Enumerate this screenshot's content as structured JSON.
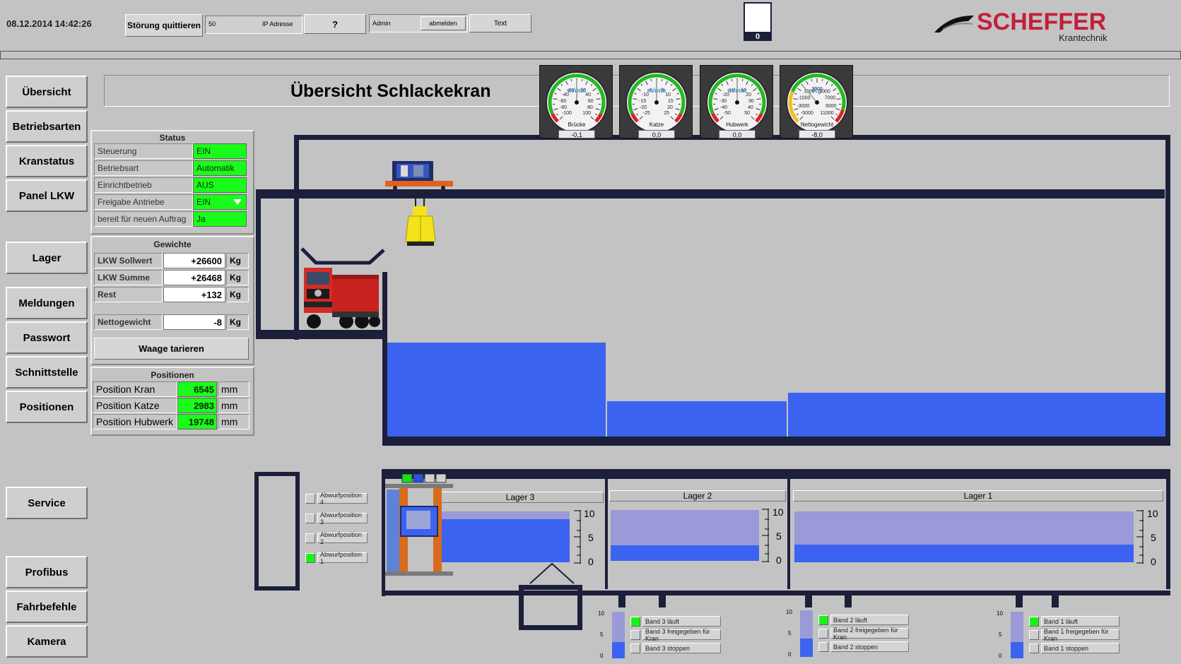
{
  "header": {
    "datetime": "08.12.2014 14:42:26",
    "ack_button": "Störung quittieren",
    "ip_value": "50",
    "ip_label": "IP Adresse",
    "help_button": "?",
    "user": "Admin",
    "logout_button": "abmelden",
    "text_button": "Text",
    "counter": "0",
    "brand": "SCHEFFER",
    "brand_sub": "Krantechnik"
  },
  "nav": {
    "items": [
      "Übersicht",
      "Betriebsarten",
      "Kranstatus",
      "Panel LKW",
      "Lager",
      "Meldungen",
      "Passwort",
      "Schnittstelle",
      "Positionen",
      "Service",
      "Profibus",
      "Fahrbefehle",
      "Kamera"
    ]
  },
  "page_title": "Übersicht Schlackekran",
  "status": {
    "title": "Status",
    "rows": [
      {
        "label": "Steuerung",
        "value": "EIN"
      },
      {
        "label": "Betriebsart",
        "value": "Automatik"
      },
      {
        "label": "Einrichtbetrieb",
        "value": "AUS"
      },
      {
        "label": "Freigabe Antriebe",
        "value": "EIN"
      },
      {
        "label": "bereit für neuen Auftrag",
        "value": "Ja"
      }
    ]
  },
  "weights": {
    "title": "Gewichte",
    "rows": [
      {
        "label": "LKW Sollwert",
        "value": "+26600",
        "unit": "Kg"
      },
      {
        "label": "LKW Summe",
        "value": "+26468",
        "unit": "Kg"
      },
      {
        "label": "Rest",
        "value": "+132",
        "unit": "Kg"
      }
    ],
    "net_label": "Nettogewicht",
    "net_value": "-8",
    "net_unit": "Kg",
    "tare_button": "Waage tarieren"
  },
  "positions": {
    "title": "Positionen",
    "rows": [
      {
        "label": "Position Kran",
        "value": "6545",
        "unit": "mm"
      },
      {
        "label": "Position Katze",
        "value": "2983",
        "unit": "mm"
      },
      {
        "label": "Position Hubwerk",
        "value": "19748",
        "unit": "mm"
      }
    ]
  },
  "gauges": [
    {
      "name": "Brücke",
      "unit": "m/min",
      "value": "-0,1",
      "ticks": [
        "-100",
        "-80",
        "-60",
        "-40",
        "-20",
        "20",
        "40",
        "60",
        "80",
        "100"
      ]
    },
    {
      "name": "Katze",
      "unit": "m/min",
      "value": "0,0",
      "ticks": [
        "-25",
        "-20",
        "-15",
        "-10",
        "-5",
        "5",
        "10",
        "15",
        "20",
        "25"
      ]
    },
    {
      "name": "Hubwerk",
      "unit": "m/min",
      "value": "0,0",
      "ticks": [
        "-50",
        "-40",
        "-30",
        "-20",
        "-10",
        "10",
        "20",
        "30",
        "40",
        "50"
      ]
    },
    {
      "name": "Nettogewicht",
      "unit": "Kg",
      "value": "-8,0",
      "ticks": [
        "-5000",
        "-3000",
        "-1000",
        "1000",
        "3000",
        "5000",
        "7000",
        "9000",
        "11000"
      ]
    }
  ],
  "storage": {
    "lager": [
      {
        "name": "Lager 3",
        "fill": 0.85
      },
      {
        "name": "Lager 2",
        "fill": 0.3
      },
      {
        "name": "Lager 1",
        "fill": 0.35
      }
    ],
    "scale": [
      "10",
      "5",
      "0"
    ]
  },
  "drop_positions": [
    {
      "label": "Abwurfposition 4",
      "active": false
    },
    {
      "label": "Abwurfposition 3",
      "active": false
    },
    {
      "label": "Abwurfposition 2",
      "active": false
    },
    {
      "label": "Abwurfposition 1",
      "active": true
    }
  ],
  "bands": [
    {
      "running": "Band 3 läuft",
      "released": "Band 3 freigegeben für Kran",
      "stop": "Band 3 stoppen",
      "fill": 0.35
    },
    {
      "running": "Band 2 läuft",
      "released": "Band 2 freigegeben für Kran",
      "stop": "Band 2 stoppen",
      "fill": 0.4
    },
    {
      "running": "Band 1 läuft",
      "released": "Band 1 freigegeben für Kran",
      "stop": "Band 1 stoppen",
      "fill": 0.35
    }
  ],
  "band_scale": [
    "10",
    "5",
    "0"
  ],
  "colors": {
    "green": "#1bfb1b",
    "blue": "#3b63f0",
    "structure": "#1b1f3a",
    "brand": "#c41e3a"
  }
}
